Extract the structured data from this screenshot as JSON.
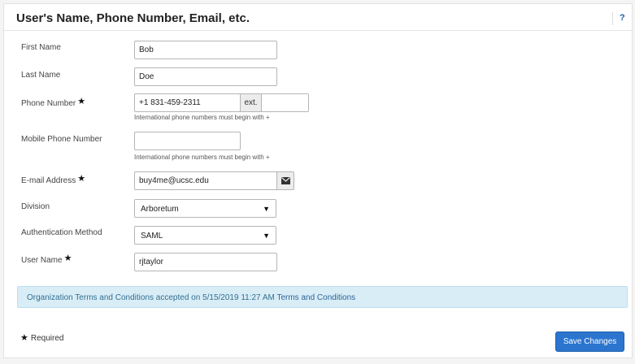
{
  "header": {
    "title": "User's Name, Phone Number, Email, etc.",
    "help_label": "?"
  },
  "form": {
    "first_name": {
      "label": "First Name",
      "value": "Bob"
    },
    "last_name": {
      "label": "Last Name",
      "value": "Doe"
    },
    "phone": {
      "label": "Phone Number",
      "required_mark": "★",
      "value": "+1 831-459-2311",
      "ext_label": "ext.",
      "ext_value": "",
      "help": "International phone numbers must begin with +"
    },
    "mobile_phone": {
      "label": "Mobile Phone Number",
      "value": "",
      "help": "International phone numbers must begin with +"
    },
    "email": {
      "label": "E-mail Address",
      "required_mark": "★",
      "value": "buy4me@ucsc.edu",
      "icon": "envelope-icon"
    },
    "division": {
      "label": "Division",
      "selected": "Arboretum"
    },
    "auth_method": {
      "label": "Authentication Method",
      "selected": "SAML"
    },
    "user_name": {
      "label": "User Name",
      "required_mark": "★",
      "value": "rjtaylor"
    }
  },
  "terms": {
    "text": "Organization Terms and Conditions accepted on 5/15/2019 11:27 AM",
    "link_label": "Terms and Conditions"
  },
  "footer": {
    "required_mark": "★",
    "required_label": "Required",
    "save_label": "Save Changes"
  },
  "colors": {
    "primary_button": "#2b75cf",
    "info_background": "#d9edf7",
    "info_text": "#31708f"
  }
}
